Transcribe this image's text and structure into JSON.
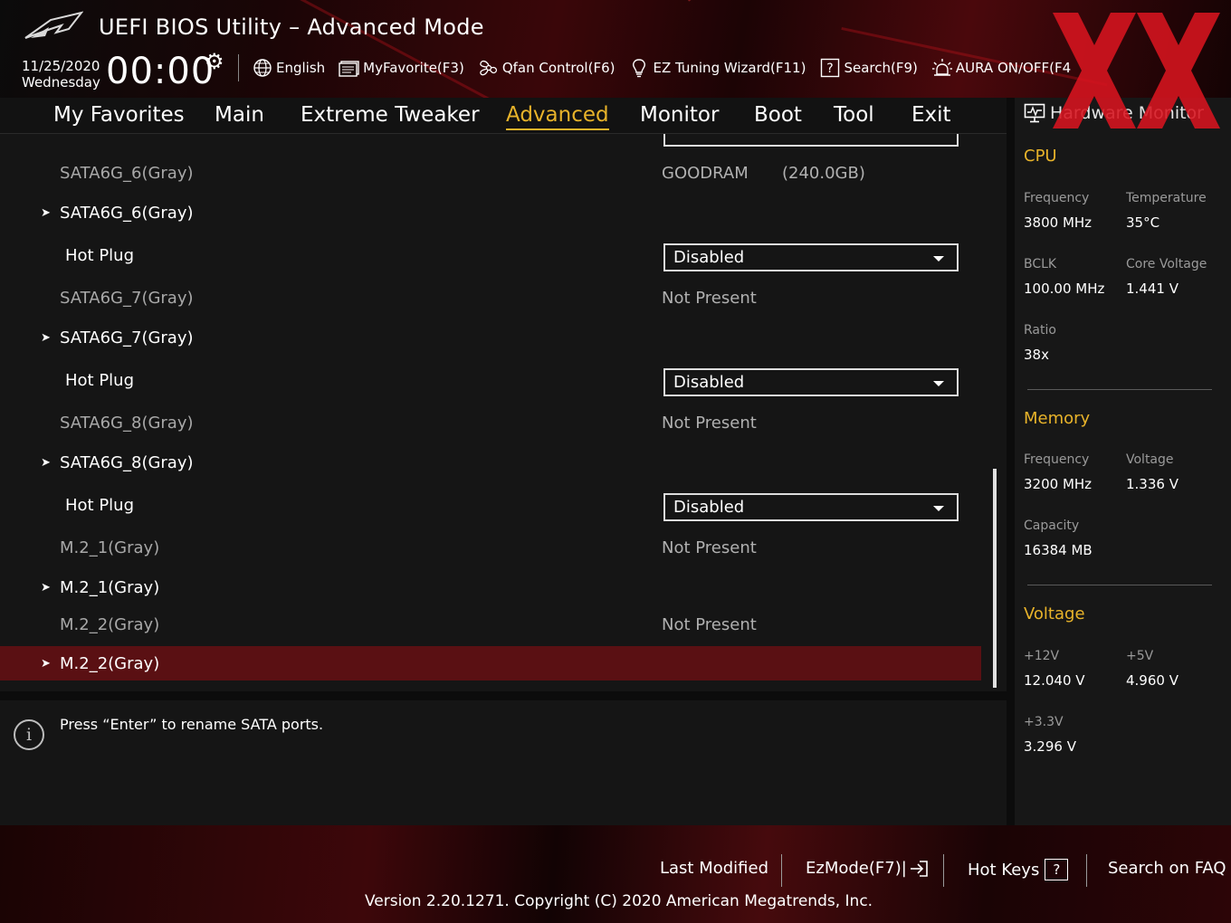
{
  "app": {
    "title": "UEFI BIOS Utility – Advanced Mode"
  },
  "header": {
    "date": "11/25/2020",
    "day": "Wednesday",
    "time": "00:00",
    "toolbar": {
      "language": "English",
      "my_favorite": "MyFavorite(F3)",
      "qfan": "Qfan Control(F6)",
      "ez_tuning": "EZ Tuning Wizard(F11)",
      "search": "Search(F9)",
      "aura": "AURA ON/OFF(F4"
    }
  },
  "tabs": [
    {
      "label": "My Favorites",
      "active": false
    },
    {
      "label": "Main",
      "active": false
    },
    {
      "label": "Extreme Tweaker",
      "active": false
    },
    {
      "label": "Advanced",
      "active": true
    },
    {
      "label": "Monitor",
      "active": false
    },
    {
      "label": "Boot",
      "active": false
    },
    {
      "label": "Tool",
      "active": false
    },
    {
      "label": "Exit",
      "active": false
    }
  ],
  "rows": [
    {
      "label": "SATA6G_6(Gray)",
      "value": "GOODRAM",
      "value2": "(240.0GB)"
    },
    {
      "label": "SATA6G_6(Gray)"
    },
    {
      "label": "Hot Plug",
      "select": "Disabled"
    },
    {
      "label": "SATA6G_7(Gray)",
      "value": "Not Present"
    },
    {
      "label": "SATA6G_7(Gray)"
    },
    {
      "label": "Hot Plug",
      "select": "Disabled"
    },
    {
      "label": "SATA6G_8(Gray)",
      "value": "Not Present"
    },
    {
      "label": "SATA6G_8(Gray)"
    },
    {
      "label": "Hot Plug",
      "select": "Disabled"
    },
    {
      "label": "M.2_1(Gray)",
      "value": "Not Present"
    },
    {
      "label": "M.2_1(Gray)"
    },
    {
      "label": "M.2_2(Gray)",
      "value": "Not Present"
    },
    {
      "label": "M.2_2(Gray)"
    }
  ],
  "help": {
    "text": "Press “Enter” to rename SATA ports."
  },
  "hardware_monitor": {
    "title": "Hardware Monitor",
    "cpu": {
      "section": "CPU",
      "frequency_label": "Frequency",
      "frequency": "3800 MHz",
      "temperature_label": "Temperature",
      "temperature": "35°C",
      "bclk_label": "BCLK",
      "bclk": "100.00 MHz",
      "core_voltage_label": "Core Voltage",
      "core_voltage": "1.441 V",
      "ratio_label": "Ratio",
      "ratio": "38x"
    },
    "memory": {
      "section": "Memory",
      "frequency_label": "Frequency",
      "frequency": "3200 MHz",
      "voltage_label": "Voltage",
      "voltage": "1.336 V",
      "capacity_label": "Capacity",
      "capacity": "16384 MB"
    },
    "voltage": {
      "section": "Voltage",
      "v12_label": "+12V",
      "v12": "12.040 V",
      "v5_label": "+5V",
      "v5": "4.960 V",
      "v33_label": "+3.3V",
      "v33": "3.296 V"
    }
  },
  "footer": {
    "last_modified": "Last Modified",
    "ezmode": "EzMode(F7)|",
    "hot_keys": "Hot Keys",
    "search_faq": "Search on FAQ",
    "version": "Version 2.20.1271. Copyright (C) 2020 American Megatrends, Inc."
  },
  "colors": {
    "accent": "#e8b32a",
    "selected_row": "#5a1013",
    "brand_red": "#c8141e"
  }
}
